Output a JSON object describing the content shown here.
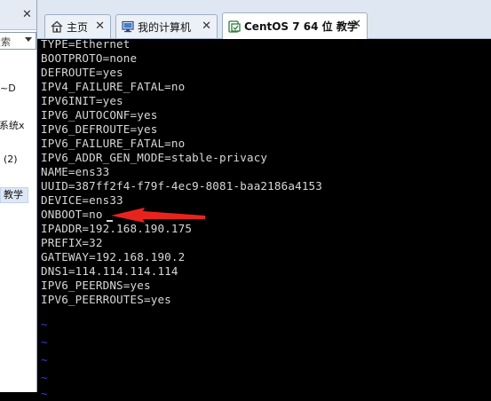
{
  "sidebar": {
    "close_symbol": "✕",
    "search_text": "搜索",
    "items": [
      {
        "label": "~D"
      },
      {
        "label": "l系统x"
      },
      {
        "label": "(2)"
      },
      {
        "label": "教学"
      }
    ]
  },
  "tabs": [
    {
      "label": "主页",
      "icon": "home-icon",
      "close": "✕"
    },
    {
      "label": "我的计算机",
      "icon": "computer-icon",
      "close": "✕"
    },
    {
      "label": "CentOS 7 64 位 教学",
      "icon": "vm-icon",
      "close": "✕",
      "active": true
    }
  ],
  "terminal": {
    "lines": [
      "TYPE=Ethernet",
      "BOOTPROTO=none",
      "DEFROUTE=yes",
      "IPV4_FAILURE_FATAL=no",
      "IPV6INIT=yes",
      "IPV6_AUTOCONF=yes",
      "IPV6_DEFROUTE=yes",
      "IPV6_FAILURE_FATAL=no",
      "IPV6_ADDR_GEN_MODE=stable-privacy",
      "NAME=ens33",
      "UUID=387ff2f4-f79f-4ec9-8081-baa2186a4153",
      "DEVICE=ens33",
      "ONBOOT=no",
      "IPADDR=192.168.190.175",
      "PREFIX=32",
      "GATEWAY=192.168.190.2",
      "DNS1=114.114.114.114",
      "IPV6_PEERDNS=yes",
      "IPV6_PEERROUTES=yes"
    ],
    "tildes": [
      "~",
      "~",
      "~",
      "~",
      "~"
    ],
    "text_color": "#d8d8d8",
    "tilde_color": "#3b3bd6",
    "annotation_color": "#e8231e"
  }
}
